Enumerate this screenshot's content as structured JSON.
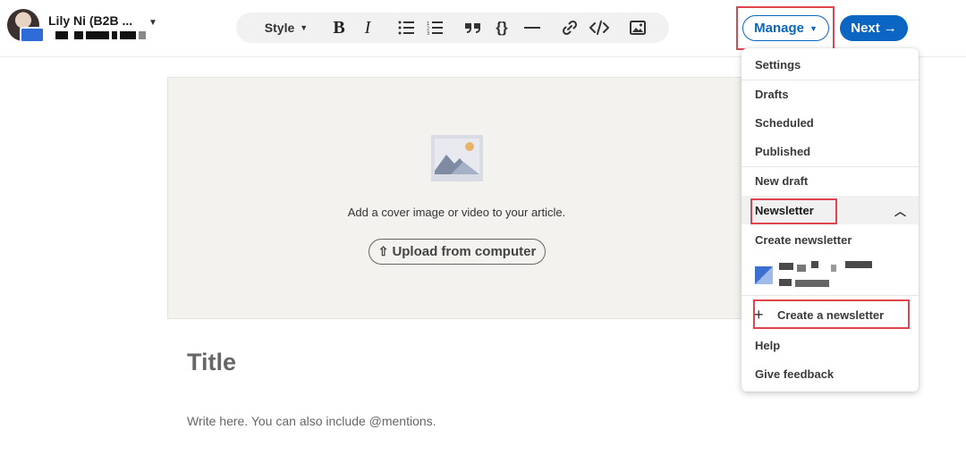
{
  "author": {
    "name": "Lily Ni (B2B ..."
  },
  "toolbar": {
    "style_label": "Style",
    "bold_label": "B",
    "italic_label": "I",
    "icons": [
      "bulleted-list-icon",
      "numbered-list-icon",
      "quote-icon",
      "code-braces-icon",
      "divider-icon",
      "link-icon",
      "embed-code-icon",
      "image-icon"
    ]
  },
  "header": {
    "manage_label": "Manage",
    "next_label": "Next"
  },
  "cover": {
    "prompt": "Add a cover image or video to your article.",
    "upload_label": "Upload from computer"
  },
  "editor": {
    "title_placeholder": "Title",
    "body_placeholder": "Write here. You can also include @mentions."
  },
  "menu": {
    "settings": "Settings",
    "drafts": "Drafts",
    "scheduled": "Scheduled",
    "published": "Published",
    "new_draft": "New draft",
    "newsletter": "Newsletter",
    "create_newsletter": "Create newsletter",
    "create_a_newsletter": "Create a newsletter",
    "help": "Help",
    "give_feedback": "Give feedback"
  },
  "colors": {
    "accent": "#0a66c2",
    "highlight": "#e0454f",
    "cover_bg": "#f3f2ef"
  }
}
